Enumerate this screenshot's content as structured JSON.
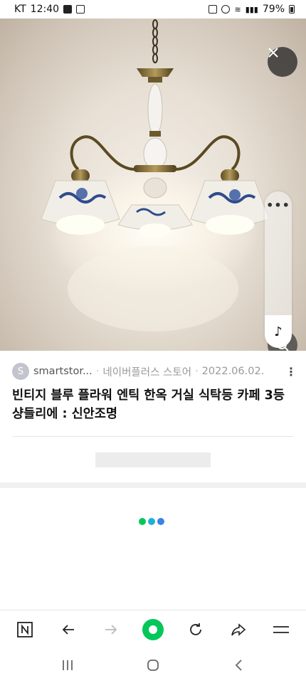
{
  "status_bar": {
    "carrier": "KT",
    "time": "12:40",
    "battery": "79%"
  },
  "source": {
    "avatar_letter": "S",
    "name": "smartstor...",
    "separator": "·",
    "store": "네이버플러스 스토어",
    "date": "2022.06.02.",
    "more": "⋮"
  },
  "title": "빈티지 블루 플라워 엔틱 한옥 거실 식탁등 카페 3등 샹들리에 : 신안조명",
  "side_panel": {
    "dots": "•••",
    "music": "♪"
  },
  "loader_colors": [
    "#03c75a",
    "#1fb0d8",
    "#3b82e6"
  ],
  "colors": {
    "accent": "#03c75a"
  },
  "icons": {
    "close": "close-icon",
    "lens": "image-search-icon",
    "toolbar": [
      "naver-n-icon",
      "back-arrow-icon",
      "forward-arrow-icon",
      "home-green-icon",
      "refresh-icon",
      "share-icon",
      "menu-icon"
    ],
    "nav": [
      "recents-icon",
      "home-icon",
      "back-icon"
    ]
  }
}
